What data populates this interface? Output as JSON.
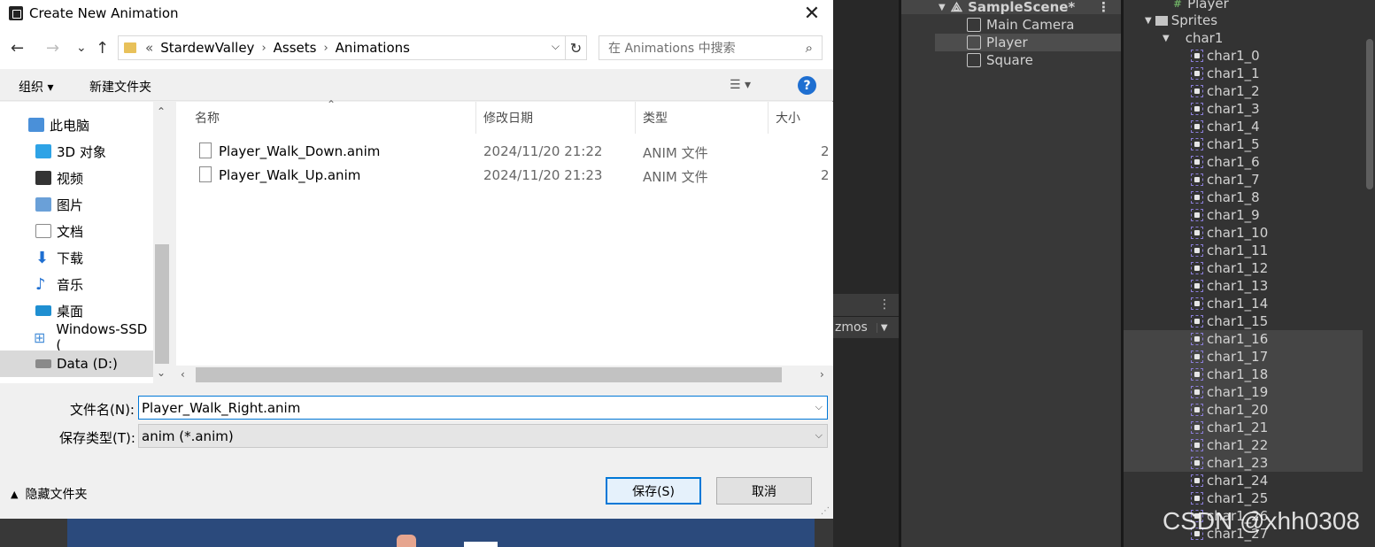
{
  "dialog": {
    "title": "Create New Animation",
    "close_glyph": "✕",
    "nav": {
      "back": "←",
      "forward": "→",
      "recent": "⌄",
      "up": "↑",
      "address_prefix": "«",
      "breadcrumbs": [
        "StardewValley",
        "Assets",
        "Animations"
      ],
      "separator": "›",
      "search_placeholder": "在 Animations 中搜索"
    },
    "toolbar": {
      "organize": "组织 ▾",
      "new_folder": "新建文件夹",
      "view": "☰ ▾",
      "help": "?"
    },
    "tree": [
      {
        "label": "此电脑",
        "icon": "computer-icon",
        "color": "#4a90d9"
      },
      {
        "label": "3D 对象",
        "icon": "cube-3d-icon",
        "color": "#2ea3e6"
      },
      {
        "label": "视频",
        "icon": "video-icon",
        "color": "#333333"
      },
      {
        "label": "图片",
        "icon": "picture-icon",
        "color": "#6aa0d8"
      },
      {
        "label": "文档",
        "icon": "document-icon",
        "color": "#8a8a8a"
      },
      {
        "label": "下载",
        "icon": "download-icon",
        "color": "#1f6fd1"
      },
      {
        "label": "音乐",
        "icon": "music-icon",
        "color": "#1f6fd1"
      },
      {
        "label": "桌面",
        "icon": "desktop-icon",
        "color": "#1f8fd1"
      },
      {
        "label": "Windows-SSD (",
        "icon": "windows-drive-icon",
        "color": "#4a90d9"
      },
      {
        "label": "Data (D:)",
        "icon": "drive-icon",
        "color": "#777777"
      }
    ],
    "columns": [
      "名称",
      "修改日期",
      "类型",
      "大小"
    ],
    "files": [
      {
        "name": "Player_Walk_Down.anim",
        "date": "2024/11/20 21:22",
        "type": "ANIM 文件",
        "size": "2"
      },
      {
        "name": "Player_Walk_Up.anim",
        "date": "2024/11/20 21:23",
        "type": "ANIM 文件",
        "size": "2"
      }
    ],
    "filename_label": "文件名(N):",
    "filename_value": "Player_Walk_Right.anim",
    "filetype_label": "保存类型(T):",
    "filetype_value": "anim (*.anim)",
    "hide_folders": "隐藏文件夹",
    "save": "保存(S)",
    "cancel": "取消"
  },
  "unity": {
    "gizmos": "zmos",
    "hierarchy": {
      "scene": "SampleScene*",
      "items": [
        "Main Camera",
        "Player",
        "Square"
      ]
    },
    "project": {
      "top_item": "Player",
      "folder": "Sprites",
      "sheet": "char1",
      "sprites": [
        "char1_0",
        "char1_1",
        "char1_2",
        "char1_3",
        "char1_4",
        "char1_5",
        "char1_6",
        "char1_7",
        "char1_8",
        "char1_9",
        "char1_10",
        "char1_11",
        "char1_12",
        "char1_13",
        "char1_14",
        "char1_15",
        "char1_16",
        "char1_17",
        "char1_18",
        "char1_19",
        "char1_20",
        "char1_21",
        "char1_22",
        "char1_23",
        "char1_24",
        "char1_25",
        "char1_26",
        "char1_27"
      ]
    },
    "watermark": "CSDN @xhh0308"
  }
}
